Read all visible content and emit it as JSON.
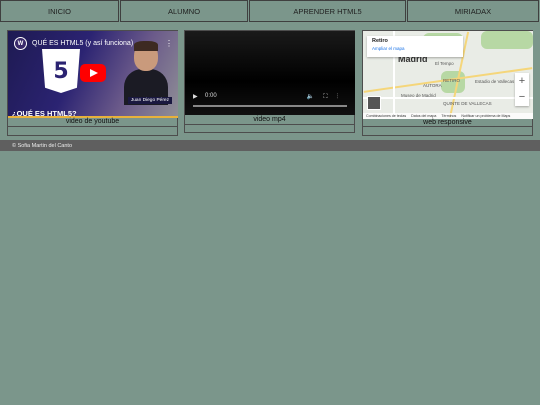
{
  "nav": [
    {
      "label": "INICIO"
    },
    {
      "label": "ALUMNO"
    },
    {
      "label": "APRENDER HTML5"
    },
    {
      "label": "MIRIADAX"
    }
  ],
  "youtube": {
    "channel_badge": "W",
    "title": "QUÉ ES HTML5 (y así funciona)",
    "logo_text": "5",
    "presenter": "Juan Diego Pérez",
    "overlay_text": "¿QUÉ ES HTML5?",
    "caption": "video de youtube"
  },
  "video": {
    "time": "0:00",
    "caption": "video mp4"
  },
  "map": {
    "city": "Madrid",
    "place": "Retiro",
    "link": "Ampliar el mapa",
    "labels": [
      "El Tempo",
      "RETIRO",
      "Museo de Madrid",
      "QUINTE DE VALLECAS",
      "Estadio de Vallecas",
      "AUTORA"
    ],
    "attribution": [
      "Combinaciones de teclas",
      "Datos del mapa",
      "Términos",
      "Notificar un problema de Maps"
    ],
    "caption": "web responsive"
  },
  "footer": {
    "text": "© Sofia Martin del Canto"
  }
}
